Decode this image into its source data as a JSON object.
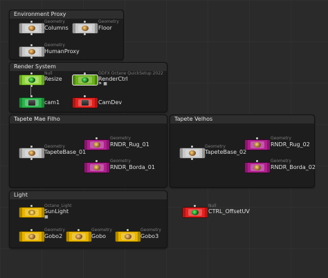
{
  "colors": {
    "geometry_gray": "#c8c8c8",
    "null_green": "#8ed43a",
    "render_ctrl_green": "#6ab01a",
    "cam_green": "#2bb24c",
    "cam_dev_red": "#e0211e",
    "rndr_magenta": "#b0208e",
    "light_yellow": "#e8b400",
    "null_red": "#e3211f"
  },
  "boxes": {
    "environment_proxy": "Environment Proxy",
    "render_system": "Render System",
    "tapete_mae_filho": "Tapete Mae Filho",
    "tapete_velhos": "Tapete Velhos",
    "light": "Light"
  },
  "nodes": {
    "columns": {
      "type": "Geometry",
      "label": "Columns"
    },
    "floor": {
      "type": "Geometry",
      "label": "Floor"
    },
    "human_proxy": {
      "type": "Geometry",
      "label": "HumanProxy"
    },
    "resize": {
      "type": "Null",
      "label": "Resize"
    },
    "render_ctrl": {
      "type": "ODFX Octane QuickSetup 2022",
      "label": "RenderCtrl"
    },
    "cam1": {
      "type": "",
      "label": "cam1"
    },
    "cam_dev": {
      "type": "",
      "label": "CamDev"
    },
    "tapete_base_01": {
      "type": "Geometry",
      "label": "TapeteBase_01"
    },
    "rndr_rug_01": {
      "type": "Geometry",
      "label": "RNDR_Rug_01"
    },
    "rndr_borda_01": {
      "type": "Geometry",
      "label": "RNDR_Borda_01"
    },
    "tapete_base_02": {
      "type": "Geometry",
      "label": "TapeteBase_02"
    },
    "rndr_rug_02": {
      "type": "Geometry",
      "label": "RNDR_Rug_02"
    },
    "rndr_borda_02": {
      "type": "Geometry",
      "label": "RNDR_Borda_02"
    },
    "sun_light": {
      "type": "Octane_Light",
      "label": "SunLight"
    },
    "ctrl_offset_uv": {
      "type": "Null",
      "label": "CTRL_OffsetUV"
    },
    "gobo2": {
      "type": "Geometry",
      "label": "Gobo2"
    },
    "gobo": {
      "type": "Geometry",
      "label": "Gobo"
    },
    "gobo3": {
      "type": "Geometry",
      "label": "Gobo3"
    }
  },
  "icons": {
    "geometry": "geometry-sphere-icon",
    "null": "null-dot-icon",
    "camera": "camera-icon",
    "light": "light-bulb-icon",
    "lock": "lock-icon",
    "flag": "flag-icon"
  }
}
